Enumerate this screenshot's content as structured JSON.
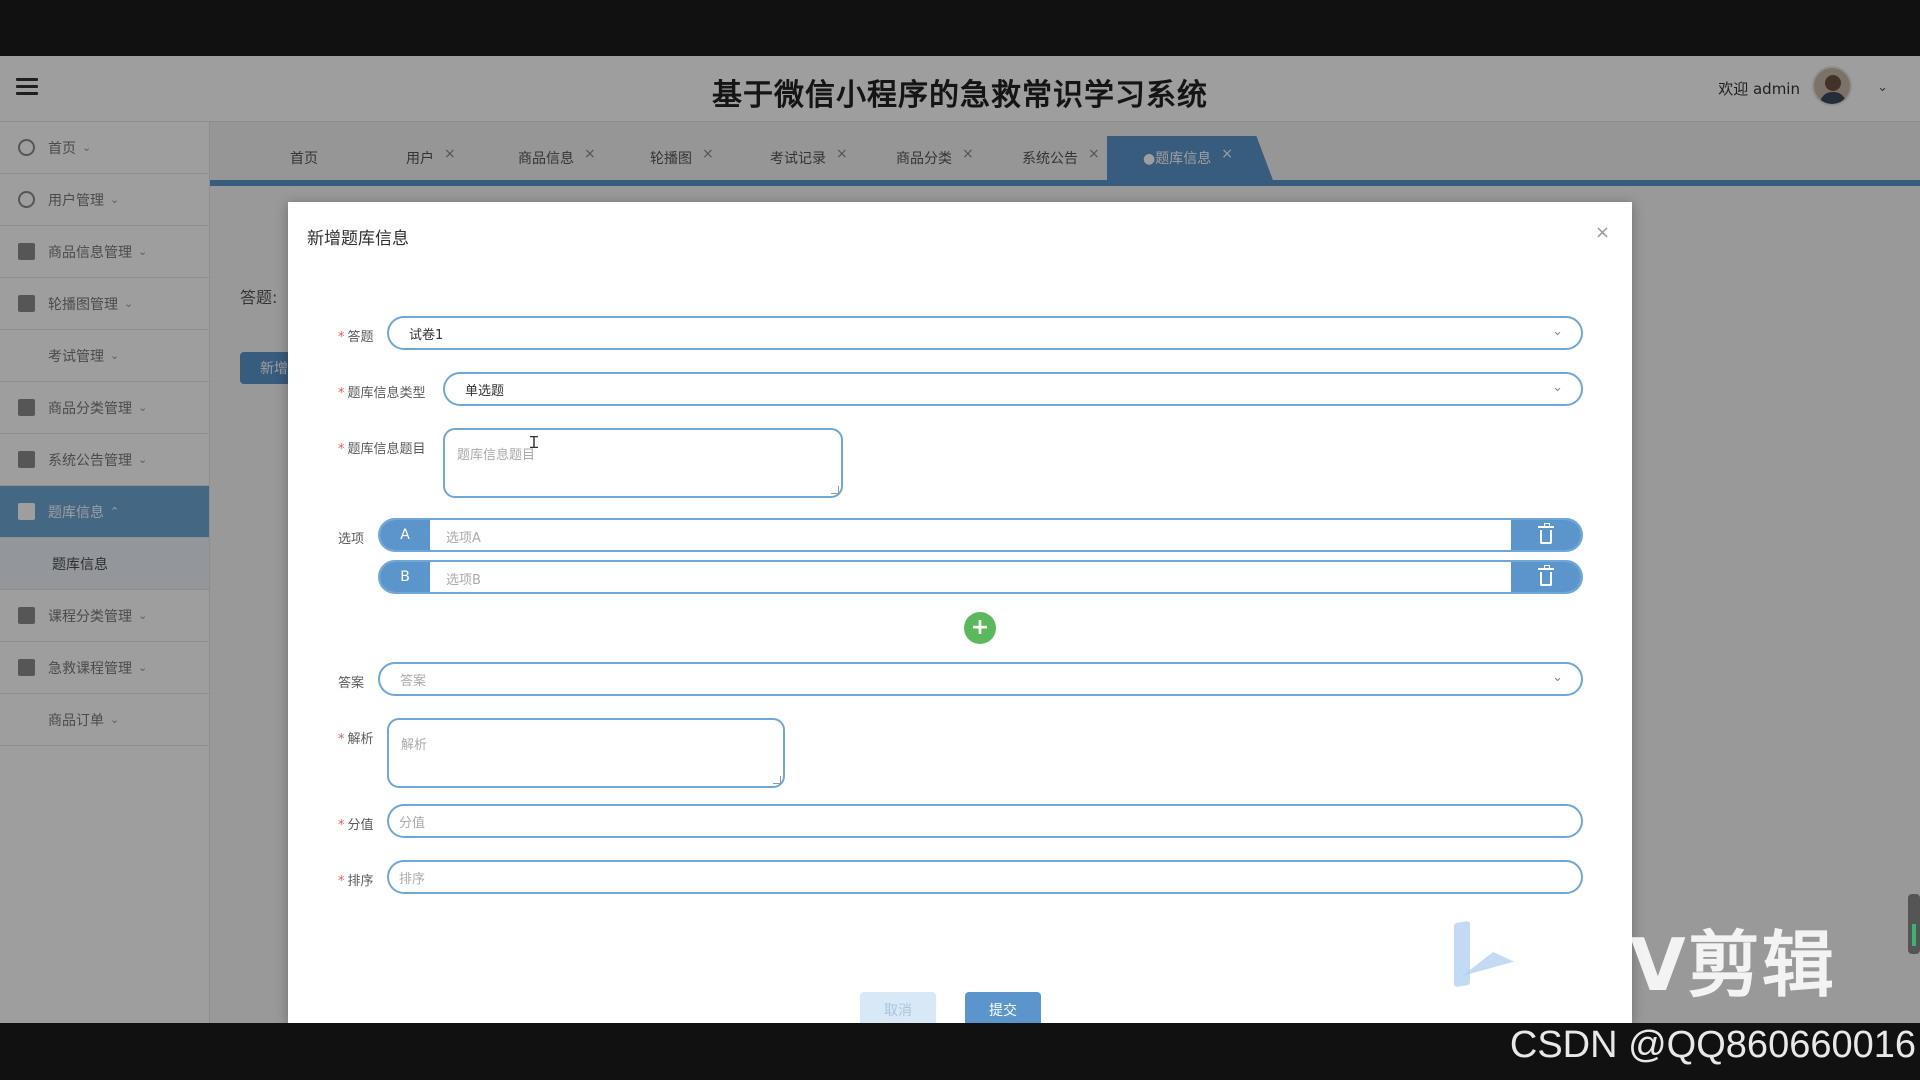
{
  "app": {
    "title": "基于微信小程序的急救常识学习系统",
    "welcome": "欢迎 admin"
  },
  "sidebar": {
    "items": [
      {
        "label": "首页",
        "icon": "home-icon"
      },
      {
        "label": "用户管理",
        "icon": "user-icon"
      },
      {
        "label": "商品信息管理",
        "icon": "table-icon"
      },
      {
        "label": "轮播图管理",
        "icon": "table-icon"
      },
      {
        "label": "考试管理",
        "icon": ""
      },
      {
        "label": "商品分类管理",
        "icon": "copy-icon"
      },
      {
        "label": "系统公告管理",
        "icon": "bag-icon"
      },
      {
        "label": "题库信息",
        "icon": "bookmark-icon"
      },
      {
        "label": "课程分类管理",
        "icon": "card-icon"
      },
      {
        "label": "急救课程管理",
        "icon": "grid-icon"
      },
      {
        "label": "商品订单",
        "icon": ""
      }
    ],
    "active_sub": "题库信息"
  },
  "tabs": [
    {
      "label": "首页",
      "closable": false
    },
    {
      "label": "用户",
      "closable": true
    },
    {
      "label": "商品信息",
      "closable": true
    },
    {
      "label": "轮播图",
      "closable": true
    },
    {
      "label": "考试记录",
      "closable": true
    },
    {
      "label": "商品分类",
      "closable": true
    },
    {
      "label": "系统公告",
      "closable": true
    },
    {
      "label": "●题库信息",
      "closable": true,
      "active": true
    }
  ],
  "tab_close": "×",
  "content": {
    "filter_label": "答题:",
    "add_button": "新增"
  },
  "dialog": {
    "title": "新增题库信息",
    "close": "×",
    "fields": {
      "exam": {
        "label": "答题",
        "value": "试卷1"
      },
      "type": {
        "label": "题库信息类型",
        "value": "单选题"
      },
      "question": {
        "label": "题库信息题目",
        "placeholder": "题库信息题目"
      },
      "options_label": "选项",
      "options": [
        {
          "letter": "A",
          "placeholder": "选项A"
        },
        {
          "letter": "B",
          "placeholder": "选项B"
        }
      ],
      "add_option": "+",
      "answer": {
        "label": "答案",
        "placeholder": "答案"
      },
      "analysis": {
        "label": "解析",
        "placeholder": "解析"
      },
      "score": {
        "label": "分值",
        "placeholder": "分值"
      },
      "order": {
        "label": "排序",
        "placeholder": "排序"
      }
    },
    "required_mark": "*",
    "cancel": "取消",
    "submit": "提交"
  },
  "watermark": {
    "editor": "剪辑",
    "editor_v": "V",
    "csdn": "CSDN @QQ860660016"
  },
  "colors": {
    "accent": "#5b95cc",
    "add_green": "#5cb85c",
    "required": "#e05a5a"
  }
}
